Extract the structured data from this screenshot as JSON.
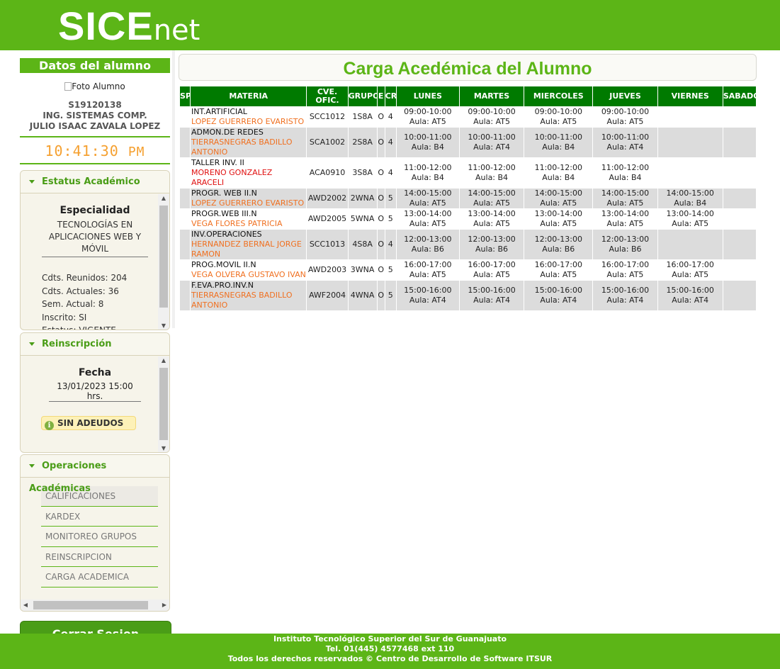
{
  "header": {
    "logo_big": "SICE",
    "logo_small": "net"
  },
  "sidebar": {
    "title": "Datos del alumno",
    "photo_alt": "Foto Alumno",
    "control_number": "S19120138",
    "career": "ING. SISTEMAS COMP.",
    "student_name": "JULIO ISAAC ZAVALA LOPEZ",
    "clock": "10:41:30",
    "clock_ampm": "PM",
    "estatus": {
      "header": "Estatus Académico",
      "esp_title": "Especialidad",
      "esp_value": "TECNOLOGÍAS EN APLICACIONES WEB Y MÓVIL",
      "cdts_reunidos": "Cdts. Reunidos: 204",
      "cdts_actuales": "Cdts. Actuales: 36",
      "sem_actual": "Sem. Actual: 8",
      "inscrito": "Inscrito: SI",
      "estatus": "Estatus: VIGENTE"
    },
    "reinscripcion": {
      "header": "Reinscripción",
      "fecha_title": "Fecha",
      "fecha_value": "13/01/2023 15:00 hrs.",
      "badge": "SIN ADEUDOS",
      "badge_icon": "info-icon"
    },
    "operaciones": {
      "header": "Operaciones Académicas",
      "items": [
        "CALIFICACIONES",
        "KARDEX",
        "MONITOREO GRUPOS",
        "REINSCRIPCION",
        "CARGA ACADEMICA"
      ]
    },
    "cerrar_label": "Cerrar Sesion"
  },
  "main": {
    "title": "Carga Acedémica del Alumno",
    "columns": [
      "SP",
      "MATERIA",
      "CVE. OFIC.",
      "GRUPO",
      "E",
      "CR",
      "LUNES",
      "MARTES",
      "MIERCOLES",
      "JUEVES",
      "VIERNES",
      "SABADO"
    ],
    "rows": [
      {
        "materia": "INT.ARTIFICIAL",
        "profesor": "LOPEZ GUERRERO EVARISTO",
        "prof_color": "orange",
        "cve": "SCC1012",
        "grupo": "1S8A",
        "e": "O",
        "cr": "4",
        "lunes": "09:00-10:00 Aula: AT5",
        "martes": "09:00-10:00 Aula: AT5",
        "miercoles": "09:00-10:00 Aula: AT5",
        "jueves": "09:00-10:00 Aula: AT5",
        "viernes": "",
        "sabado": ""
      },
      {
        "materia": "ADMON.DE REDES",
        "profesor": "TIERRASNEGRAS BADILLO ANTONIO",
        "prof_color": "orange",
        "cve": "SCA1002",
        "grupo": "2S8A",
        "e": "O",
        "cr": "4",
        "lunes": "10:00-11:00 Aula: B4",
        "martes": "10:00-11:00 Aula: AT4",
        "miercoles": "10:00-11:00 Aula: B4",
        "jueves": "10:00-11:00 Aula: AT4",
        "viernes": "",
        "sabado": ""
      },
      {
        "materia": "TALLER INV. II",
        "profesor": "MORENO GONZALEZ ARACELI",
        "prof_color": "red",
        "cve": "ACA0910",
        "grupo": "3S8A",
        "e": "O",
        "cr": "4",
        "lunes": "11:00-12:00 Aula: B4",
        "martes": "11:00-12:00 Aula: B4",
        "miercoles": "11:00-12:00 Aula: B4",
        "jueves": "11:00-12:00 Aula: B4",
        "viernes": "",
        "sabado": ""
      },
      {
        "materia": "PROGR. WEB II.N",
        "profesor": "LOPEZ GUERRERO EVARISTO",
        "prof_color": "orange",
        "cve": "AWD2002",
        "grupo": "2WNA",
        "e": "O",
        "cr": "5",
        "lunes": "14:00-15:00 Aula: AT5",
        "martes": "14:00-15:00 Aula: AT5",
        "miercoles": "14:00-15:00 Aula: AT5",
        "jueves": "14:00-15:00 Aula: AT5",
        "viernes": "14:00-15:00 Aula: B4",
        "sabado": ""
      },
      {
        "materia": "PROGR.WEB III.N",
        "profesor": "VEGA FLORES PATRICIA",
        "prof_color": "orange",
        "cve": "AWD2005",
        "grupo": "5WNA",
        "e": "O",
        "cr": "5",
        "lunes": "13:00-14:00 Aula: AT5",
        "martes": "13:00-14:00 Aula: AT5",
        "miercoles": "13:00-14:00 Aula: AT5",
        "jueves": "13:00-14:00 Aula: AT5",
        "viernes": "13:00-14:00 Aula: AT5",
        "sabado": ""
      },
      {
        "materia": "INV.OPERACIONES",
        "profesor": "HERNANDEZ BERNAL JORGE RAMON",
        "prof_color": "orange",
        "cve": "SCC1013",
        "grupo": "4S8A",
        "e": "O",
        "cr": "4",
        "lunes": "12:00-13:00 Aula: B6",
        "martes": "12:00-13:00 Aula: B6",
        "miercoles": "12:00-13:00 Aula: B6",
        "jueves": "12:00-13:00 Aula: B6",
        "viernes": "",
        "sabado": ""
      },
      {
        "materia": "PROG.MOVIL II.N",
        "profesor": "VEGA OLVERA GUSTAVO IVAN",
        "prof_color": "orange",
        "cve": "AWD2003",
        "grupo": "3WNA",
        "e": "O",
        "cr": "5",
        "lunes": "16:00-17:00 Aula: AT5",
        "martes": "16:00-17:00 Aula: AT5",
        "miercoles": "16:00-17:00 Aula: AT5",
        "jueves": "16:00-17:00 Aula: AT5",
        "viernes": "16:00-17:00 Aula: AT5",
        "sabado": ""
      },
      {
        "materia": "F.EVA.PRO.INV.N",
        "profesor": "TIERRASNEGRAS BADILLO ANTONIO",
        "prof_color": "orange",
        "cve": "AWF2004",
        "grupo": "4WNA",
        "e": "O",
        "cr": "5",
        "lunes": "15:00-16:00 Aula: AT4",
        "martes": "15:00-16:00 Aula: AT4",
        "miercoles": "15:00-16:00 Aula: AT4",
        "jueves": "15:00-16:00 Aula: AT4",
        "viernes": "15:00-16:00 Aula: AT4",
        "sabado": ""
      }
    ]
  },
  "footer": {
    "line1": "Instituto Tecnológico Superior del Sur de Guanajuato",
    "line2": "Tel. 01(445) 4577468 ext 110",
    "line3": "Todos los derechos reservados © Centro de Desarrollo de Software ITSUR"
  },
  "colors": {
    "brand_green": "#5cb517",
    "table_header": "#007a00",
    "accent_orange": "#f07020",
    "clock_orange": "#f5a030"
  }
}
